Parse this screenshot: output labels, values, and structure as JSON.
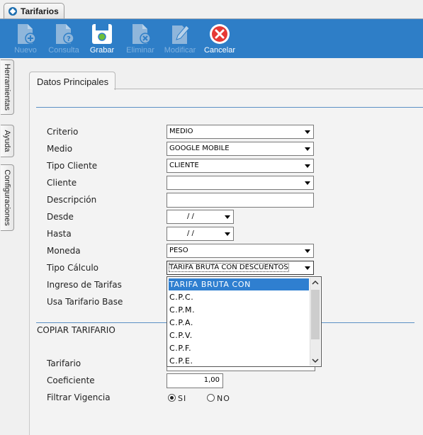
{
  "window_tab": {
    "label": "Tarifarios"
  },
  "toolbar": {
    "nuevo": "Nuevo",
    "consulta": "Consulta",
    "grabar": "Grabar",
    "eliminar": "Eliminar",
    "modificar": "Modificar",
    "cancelar": "Cancelar"
  },
  "side_tabs": [
    "Herramientas",
    "Ayuda",
    "Configuraciones"
  ],
  "panel_tab": "Datos Principales",
  "form": {
    "criterio": {
      "label": "Criterio",
      "value": "MEDIO"
    },
    "medio": {
      "label": "Medio",
      "value": "GOOGLE MOBILE"
    },
    "tipo_cliente": {
      "label": "Tipo Cliente",
      "value": "CLIENTE"
    },
    "cliente": {
      "label": "Cliente",
      "value": ""
    },
    "descripcion": {
      "label": "Descripción",
      "value": ""
    },
    "desde": {
      "label": "Desde",
      "value": "/ /"
    },
    "hasta": {
      "label": "Hasta",
      "value": "/ /"
    },
    "moneda": {
      "label": "Moneda",
      "value": "PESO"
    },
    "tipo_calculo": {
      "label": "Tipo Cálculo",
      "value": "TARIFA BRUTA CON DESCUENTOS"
    },
    "ingreso_tarifas": {
      "label": "Ingreso de Tarifas"
    },
    "usa_tarifario_base": {
      "label": "Usa Tarifario Base"
    }
  },
  "dropdown_options": [
    "TARIFA BRUTA CON DESCUENTOS",
    "C.P.C.",
    "C.P.M.",
    "C.P.A.",
    "C.P.V.",
    "C.P.F.",
    "C.P.E."
  ],
  "copiar": {
    "title": "COPIAR TARIFARIO",
    "tarifario": "Tarifario",
    "coeficiente": {
      "label": "Coeficiente",
      "value": "1,00"
    },
    "filtrar_vigencia": "Filtrar Vigencia",
    "radio_si": "SI",
    "radio_no": "NO"
  },
  "colors": {
    "toolbar": "#2e7ec7",
    "selected": "#2f7fd0",
    "accent_line": "#5b8fc4"
  }
}
